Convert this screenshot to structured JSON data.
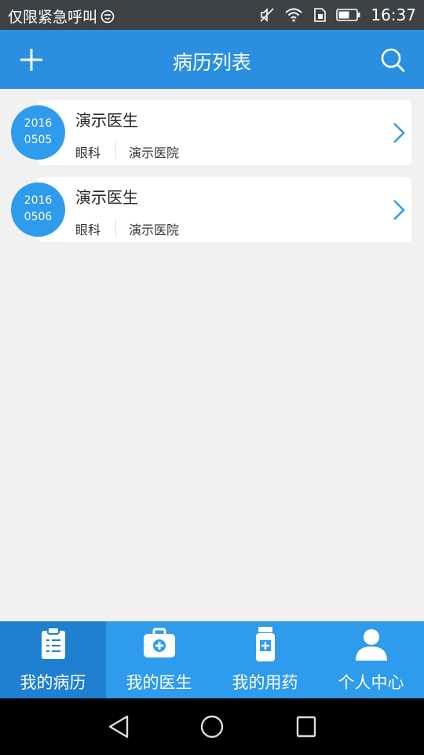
{
  "status_bar": {
    "carrier": "仅限紧急呼叫",
    "time": "16:37"
  },
  "app_bar": {
    "title": "病历列表",
    "add_icon": "plus-icon",
    "search_icon": "search-icon"
  },
  "records": [
    {
      "date_year": "2016",
      "date_md": "0505",
      "doctor": "演示医生",
      "department": "眼科",
      "hospital": "演示医院"
    },
    {
      "date_year": "2016",
      "date_md": "0506",
      "doctor": "演示医生",
      "department": "眼科",
      "hospital": "演示医院"
    }
  ],
  "bottom_nav": [
    {
      "label": "我的病历",
      "icon": "clipboard-list-icon",
      "active": true
    },
    {
      "label": "我的医生",
      "icon": "medical-kit-icon",
      "active": false
    },
    {
      "label": "我的用药",
      "icon": "medicine-bottle-icon",
      "active": false
    },
    {
      "label": "个人中心",
      "icon": "person-icon",
      "active": false
    }
  ],
  "colors": {
    "primary": "#2a8fe0",
    "nav_bg": "#2e9bec",
    "nav_active": "#1f7fd0",
    "background": "#f1f1f1"
  }
}
